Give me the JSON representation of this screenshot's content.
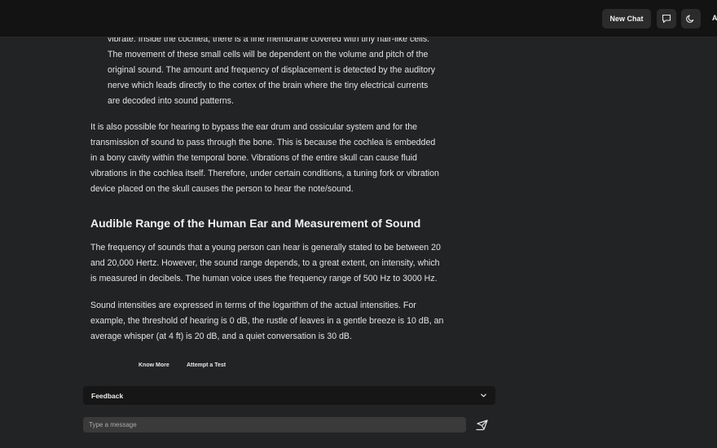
{
  "header": {
    "new_chat_label": "New Chat",
    "chat_icon": "chat-bubble-icon",
    "theme_icon": "moon-icon",
    "avatar_letter": "A"
  },
  "article": {
    "indented_lines": [
      "vibrate. Inside the cochlea, there is a fine membrane covered with tiny hair-like cells.",
      "The movement of these small cells will be dependent on the volume and pitch of the",
      "original sound. The amount and frequency of displacement is detected by the auditory",
      "nerve which leads directly to the cortex of the brain where the tiny electrical currents",
      "are decoded into sound patterns."
    ],
    "para1_lines": [
      "It is also possible for hearing to bypass the ear drum and ossicular system and for the",
      "transmission of sound to pass through the bone. This is because the cochlea is embedded",
      "in a bony cavity within the temporal bone. Vibrations of the entire skull can cause fluid",
      "vibrations in the cochlea itself. Therefore, under certain conditions, a tuning fork or vibration",
      "device placed on the skull causes the person to hear the note/sound."
    ],
    "heading": "Audible Range of the Human Ear and Measurement of Sound",
    "para2_lines": [
      "The frequency of sounds that a young person can hear is generally stated to be between 20",
      "and 20,000 Hertz. However, the sound range depends, to a great extent, on intensity, which",
      "is measured in decibels. The human voice uses the frequency range of 500 Hz to 3000 Hz."
    ],
    "para3_lines": [
      "Sound intensities are expressed in terms of the logarithm of the actual intensities. For",
      "example, the threshold of hearing is 0 dB, the rustle of leaves in a gentle breeze is 10 dB, an",
      "average whisper (at 4 ft) is 20 dB, and a quiet conversation is 30 dB."
    ]
  },
  "actions": {
    "know_more": "Know More",
    "attempt_test": "Attempt a Test"
  },
  "feedback": {
    "label": "Feedback"
  },
  "composer": {
    "placeholder": "Type a message",
    "value": ""
  }
}
